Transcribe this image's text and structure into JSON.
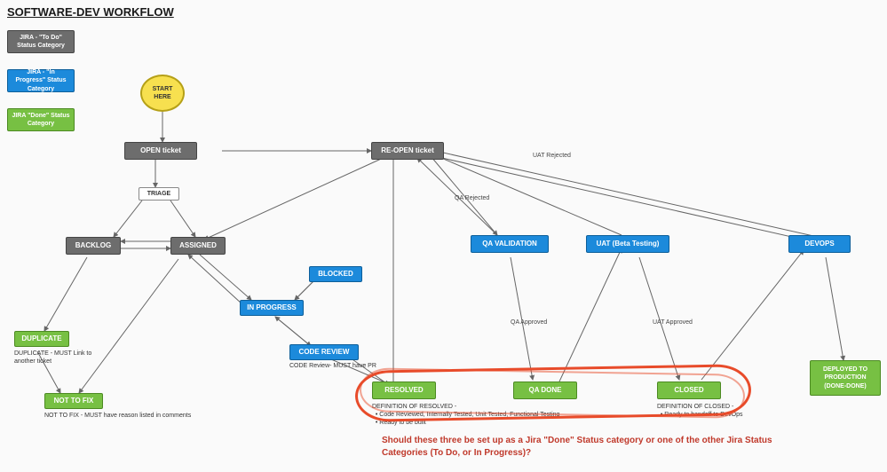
{
  "title": "SOFTWARE-DEV WORKFLOW",
  "legend": {
    "todo": "JIRA - \"To Do\" Status Category",
    "inprogress": "JIRA - \"In Progress\" Status Category",
    "done": "JIRA \"Done\" Status Category"
  },
  "start": "START HERE",
  "nodes": {
    "open": "OPEN ticket",
    "triage": "TRIAGE",
    "backlog": "BACKLOG",
    "assigned": "ASSIGNED",
    "inprogress": "IN PROGRESS",
    "blocked": "BLOCKED",
    "codereview": "CODE REVIEW",
    "duplicate": "DUPLICATE",
    "nottofix": "NOT TO FIX",
    "reopen": "RE-OPEN ticket",
    "qavalidation": "QA VALIDATION",
    "uat": "UAT (Beta Testing)",
    "devops": "DEVOPS",
    "resolved": "RESOLVED",
    "qadone": "QA DONE",
    "closed": "CLOSED",
    "deployed": "DEPLOYED TO PRODUCTION (DONE-DONE)"
  },
  "notes": {
    "duplicate": "DUPLICATE - MUST Link to another ticket",
    "nottofix": "NOT TO FIX - MUST have reason listed in comments",
    "codereview": "CODE Review- MUST have PR",
    "resolved_title": "DEFINITION OF RESOLVED -",
    "resolved_b1": "Code Reviewed, Internally Tested, Unit Tested, Functional Testing",
    "resolved_b2": "Ready to be built",
    "closed_title": "DEFINITION OF CLOSED -",
    "closed_b1": "Ready to handoff to DevOps"
  },
  "edge_labels": {
    "qa_rejected": "QA Rejected",
    "qa_approved": "QA Approved",
    "uat_rejected": "UAT Rejected",
    "uat_approved": "UAT Approved"
  },
  "annotation": "Should these three be set up as a Jira \"Done\" Status category or one of the other Jira Status Categories (To Do, or In Progress)?",
  "colors": {
    "grey": "#6d6d6d",
    "blue": "#1c8adb",
    "green": "#77c043",
    "yellow": "#f7e04f",
    "annotation": "#e84b2a"
  },
  "chart_data": {
    "type": "flowchart",
    "nodes": [
      {
        "id": "start",
        "label": "START HERE",
        "category": "start"
      },
      {
        "id": "open",
        "label": "OPEN ticket",
        "category": "todo"
      },
      {
        "id": "triage",
        "label": "TRIAGE",
        "category": "neutral"
      },
      {
        "id": "backlog",
        "label": "BACKLOG",
        "category": "todo"
      },
      {
        "id": "assigned",
        "label": "ASSIGNED",
        "category": "todo"
      },
      {
        "id": "inprogress",
        "label": "IN PROGRESS",
        "category": "inprogress"
      },
      {
        "id": "blocked",
        "label": "BLOCKED",
        "category": "inprogress"
      },
      {
        "id": "codereview",
        "label": "CODE REVIEW",
        "category": "inprogress"
      },
      {
        "id": "duplicate",
        "label": "DUPLICATE",
        "category": "done"
      },
      {
        "id": "nottofix",
        "label": "NOT TO FIX",
        "category": "done"
      },
      {
        "id": "reopen",
        "label": "RE-OPEN ticket",
        "category": "todo"
      },
      {
        "id": "qavalidation",
        "label": "QA VALIDATION",
        "category": "inprogress"
      },
      {
        "id": "uat",
        "label": "UAT (Beta Testing)",
        "category": "inprogress"
      },
      {
        "id": "devops",
        "label": "DEVOPS",
        "category": "inprogress"
      },
      {
        "id": "resolved",
        "label": "RESOLVED",
        "category": "done"
      },
      {
        "id": "qadone",
        "label": "QA DONE",
        "category": "done"
      },
      {
        "id": "closed",
        "label": "CLOSED",
        "category": "done"
      },
      {
        "id": "deployed",
        "label": "DEPLOYED TO PRODUCTION (DONE-DONE)",
        "category": "done"
      }
    ],
    "edges": [
      {
        "from": "start",
        "to": "open"
      },
      {
        "from": "open",
        "to": "triage"
      },
      {
        "from": "triage",
        "to": "backlog"
      },
      {
        "from": "triage",
        "to": "assigned"
      },
      {
        "from": "backlog",
        "to": "assigned"
      },
      {
        "from": "assigned",
        "to": "backlog"
      },
      {
        "from": "assigned",
        "to": "inprogress"
      },
      {
        "from": "assigned",
        "to": "reopen"
      },
      {
        "from": "backlog",
        "to": "duplicate"
      },
      {
        "from": "backlog",
        "to": "nottofix"
      },
      {
        "from": "assigned",
        "to": "nottofix"
      },
      {
        "from": "inprogress",
        "to": "blocked"
      },
      {
        "from": "blocked",
        "to": "inprogress"
      },
      {
        "from": "inprogress",
        "to": "codereview"
      },
      {
        "from": "codereview",
        "to": "inprogress"
      },
      {
        "from": "codereview",
        "to": "resolved"
      },
      {
        "from": "resolved",
        "to": "qavalidation"
      },
      {
        "from": "qavalidation",
        "to": "reopen",
        "label": "QA Rejected"
      },
      {
        "from": "qavalidation",
        "to": "qadone",
        "label": "QA Approved"
      },
      {
        "from": "qadone",
        "to": "uat"
      },
      {
        "from": "uat",
        "to": "reopen",
        "label": "UAT Rejected"
      },
      {
        "from": "uat",
        "to": "closed",
        "label": "UAT Approved"
      },
      {
        "from": "closed",
        "to": "devops"
      },
      {
        "from": "devops",
        "to": "deployed"
      },
      {
        "from": "devops",
        "to": "reopen"
      },
      {
        "from": "reopen",
        "to": "assigned"
      }
    ],
    "annotation_highlight": [
      "resolved",
      "qadone",
      "closed"
    ]
  }
}
